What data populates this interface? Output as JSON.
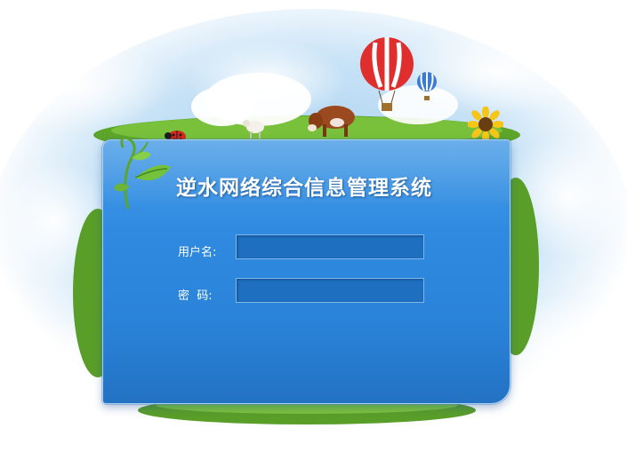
{
  "login": {
    "title": "逆水网络综合信息管理系统",
    "username_label": "用户名:",
    "username_value": "",
    "password_label": "密  码:",
    "password_value": ""
  },
  "decorations": {
    "icons": [
      "cloud-icon",
      "hot-air-balloon-icon",
      "sunflower-icon",
      "cow-icon",
      "sheep-icon",
      "ladybug-icon",
      "vine-sprout-icon",
      "grass-icon"
    ]
  },
  "colors": {
    "panel_blue": "#2f8ae0",
    "input_blue": "#1f6fc0",
    "input_border": "#7fb8ea",
    "title_text": "#ffffff"
  }
}
